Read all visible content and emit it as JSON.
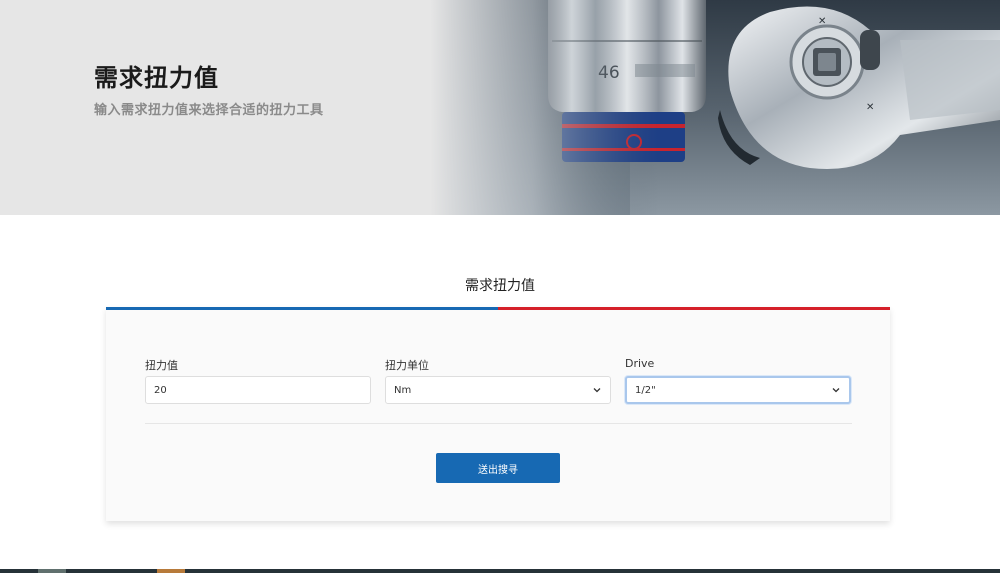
{
  "hero": {
    "title": "需求扭力值",
    "subtitle": "输入需求扭力值来选择合适的扭力工具",
    "image_text": "46"
  },
  "section": {
    "title": "需求扭力值"
  },
  "form": {
    "torque": {
      "label": "扭力值",
      "value": "20"
    },
    "unit": {
      "label": "扭力单位",
      "value": "Nm"
    },
    "drive": {
      "label": "Drive",
      "value": "1/2\""
    },
    "submit_label": "送出搜寻"
  },
  "colors": {
    "brand_blue": "#1769b3",
    "brand_red": "#d5202a",
    "hero_bg": "#e6e6e6"
  }
}
